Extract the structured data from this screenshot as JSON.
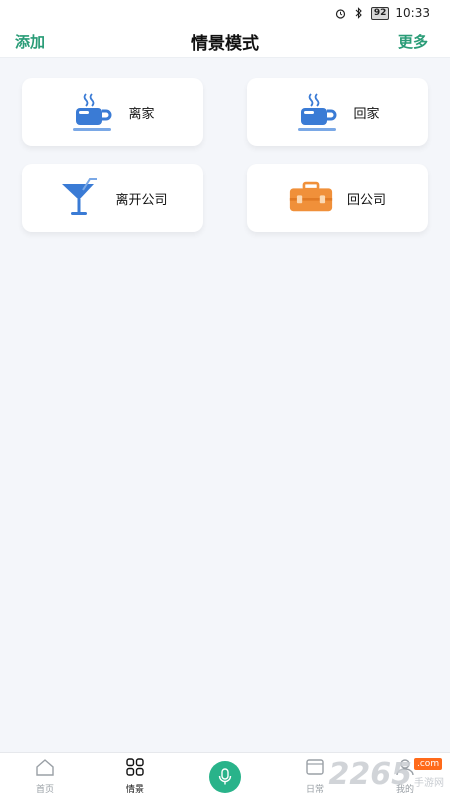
{
  "status_bar": {
    "battery": "92",
    "time": "10:33"
  },
  "header": {
    "left": "添加",
    "title": "情景模式",
    "right": "更多"
  },
  "scenes": [
    {
      "label": "离家",
      "icon": "coffee-cup-icon"
    },
    {
      "label": "回家",
      "icon": "coffee-cup-icon"
    },
    {
      "label": "离开公司",
      "icon": "cocktail-glass-icon"
    },
    {
      "label": "回公司",
      "icon": "briefcase-icon"
    }
  ],
  "nav": {
    "home": "首页",
    "scene": "情景",
    "daily": "日常",
    "mine": "我的"
  },
  "watermark": {
    "number": "2265",
    "badge": ".com",
    "text": "手游网"
  },
  "colors": {
    "accent": "#2a9c77",
    "mic": "#29b38a",
    "cup": "#3a7bd5",
    "briefcase": "#f0903a"
  }
}
